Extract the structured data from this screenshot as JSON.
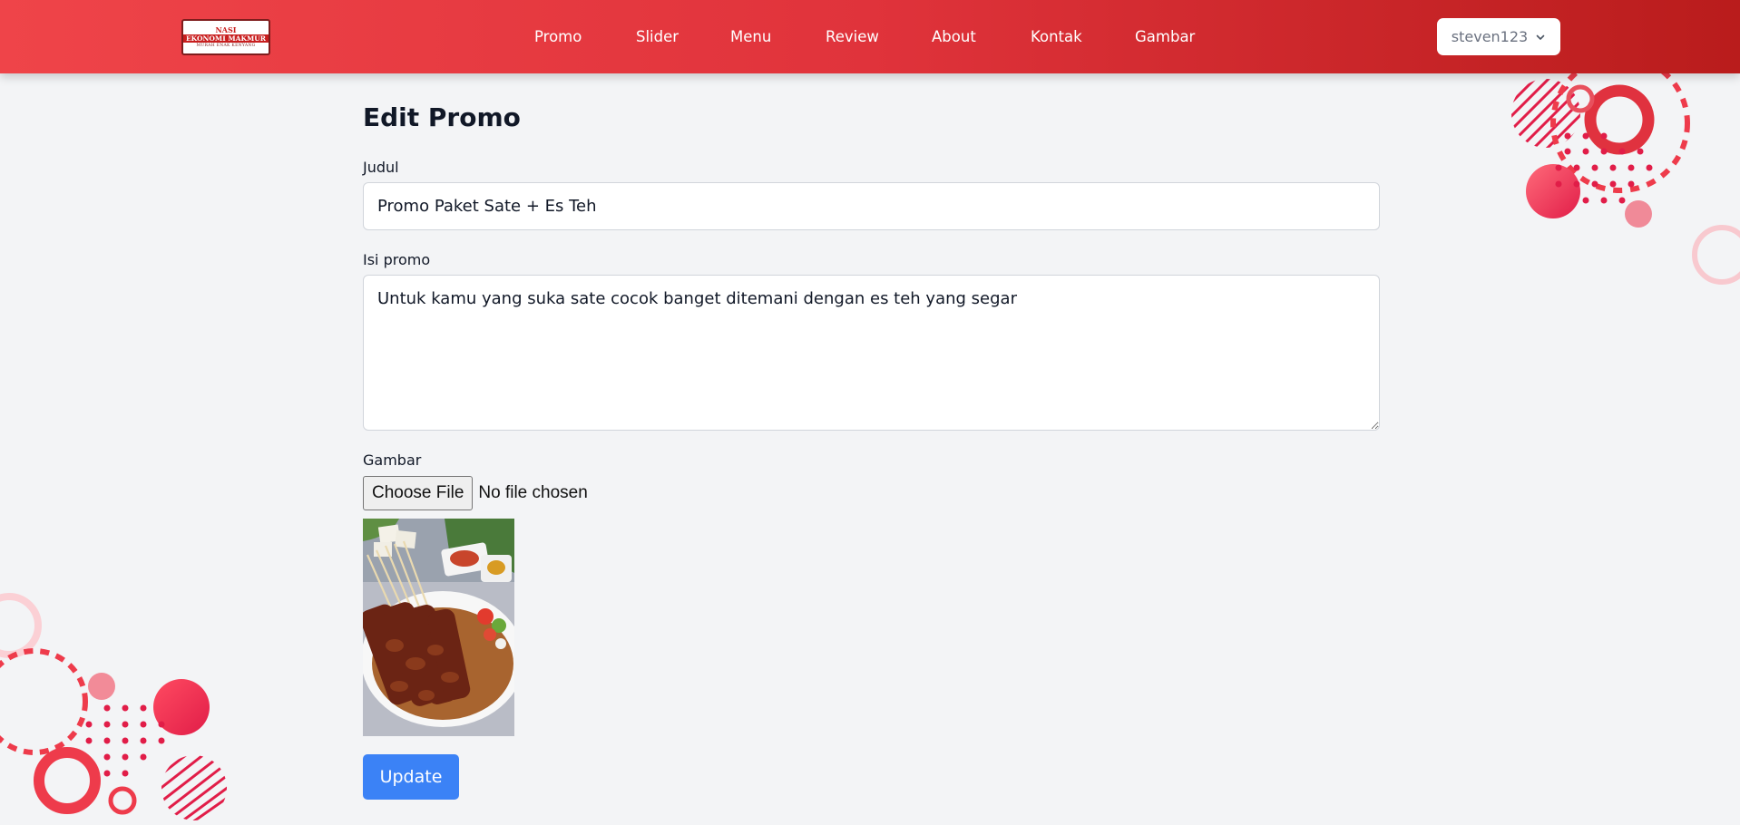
{
  "brand": {
    "logo_line1": "NASI",
    "logo_line2": "EKONOMI MAKMUR",
    "logo_line3": "MURAH ENAK KENYANG"
  },
  "nav": {
    "links": [
      "Promo",
      "Slider",
      "Menu",
      "Review",
      "About",
      "Kontak",
      "Gambar"
    ]
  },
  "user": {
    "name": "steven123",
    "dropdown_icon": "chevron-down-icon"
  },
  "form": {
    "title": "Edit Promo",
    "judul_label": "Judul",
    "judul_value": "Promo Paket Sate + Es Teh",
    "isi_label": "Isi promo",
    "isi_value": "Untuk kamu yang suka sate cocok banget ditemani dengan es teh yang segar",
    "gambar_label": "Gambar",
    "file_button": "Choose File",
    "file_status": "No file chosen",
    "submit_label": "Update"
  },
  "colors": {
    "navbar_start": "#ef4449",
    "navbar_end": "#b91c1c",
    "button_primary": "#3b82f6",
    "background": "#f3f4f6"
  }
}
